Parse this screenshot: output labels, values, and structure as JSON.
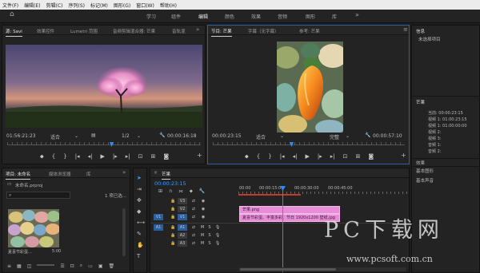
{
  "menubar": {
    "items": [
      "文件(F)",
      "编辑(E)",
      "剪辑(C)",
      "序列(S)",
      "标记(M)",
      "图形(G)",
      "窗口(W)",
      "帮助(H)"
    ]
  },
  "workspace": {
    "tabs": [
      "学习",
      "组件",
      "编辑",
      "颜色",
      "效果",
      "音频",
      "图形",
      "库"
    ],
    "more": "»"
  },
  "source_panel": {
    "tabs": [
      "源: Savi",
      "效果控件",
      "Lumetri 范围",
      "音频剪辑混合器: 芒果",
      "音轨混"
    ],
    "more": "»",
    "timecode_left": "01:56:21:23",
    "fit": "适合",
    "ratio": "1/2",
    "timecode_right": "00:00:16:18"
  },
  "program_panel": {
    "tabs": [
      "节目: 芒果",
      "字幕（无字幕）",
      "参考: 芒果"
    ],
    "menu": "≡",
    "timecode_left": "00:00:23:15",
    "fit": "适合",
    "quality": "完整",
    "timecode_right": "00:00:57:10"
  },
  "info_panel": {
    "title": "信息",
    "status": "未选择项目",
    "section2_title": "芒果",
    "section2_rows": [
      "当前: 00:00:23:15",
      "视频 1: 01:00:23:15",
      "视频 1: 01:00:00:00",
      "视频 2:",
      "视频 3:",
      "音频 1:",
      "音频 2:"
    ],
    "section3_title": "效果",
    "section4_title": "基本图形",
    "section5_title": "基本声音"
  },
  "project_panel": {
    "tabs": [
      "项目: 未命名",
      "媒体浏览器",
      "库"
    ],
    "more": "»",
    "project_name": "未命名.prproj",
    "item_count": "1 项已选...",
    "search_placeholder": "",
    "clip_name": "夏喜节彩蛋...",
    "clip_duration": "5:00"
  },
  "timeline_panel": {
    "tab": "芒果",
    "timecode": "00:00:23:15",
    "ruler": [
      "00:00",
      "00:00:15:00",
      "00:00:30:00",
      "00:00:45:00"
    ],
    "tracks": [
      {
        "name": "V3",
        "target": ""
      },
      {
        "name": "V2",
        "target": ""
      },
      {
        "name": "V1",
        "target": "V1"
      },
      {
        "name": "A1",
        "target": "A1"
      },
      {
        "name": "A2",
        "target": ""
      },
      {
        "name": "A3",
        "target": ""
      }
    ],
    "clip_v2": "芒果.png",
    "clip_v1": "夏喜节彩蛋、丰富多彩、节日 1920x1200 壁纸.jpg"
  },
  "watermark": {
    "title": "PC下载网",
    "url": "www.pcsoft.com.cn"
  },
  "colors": {
    "accent": "#2a8cff",
    "clip": "#e68ed6"
  }
}
